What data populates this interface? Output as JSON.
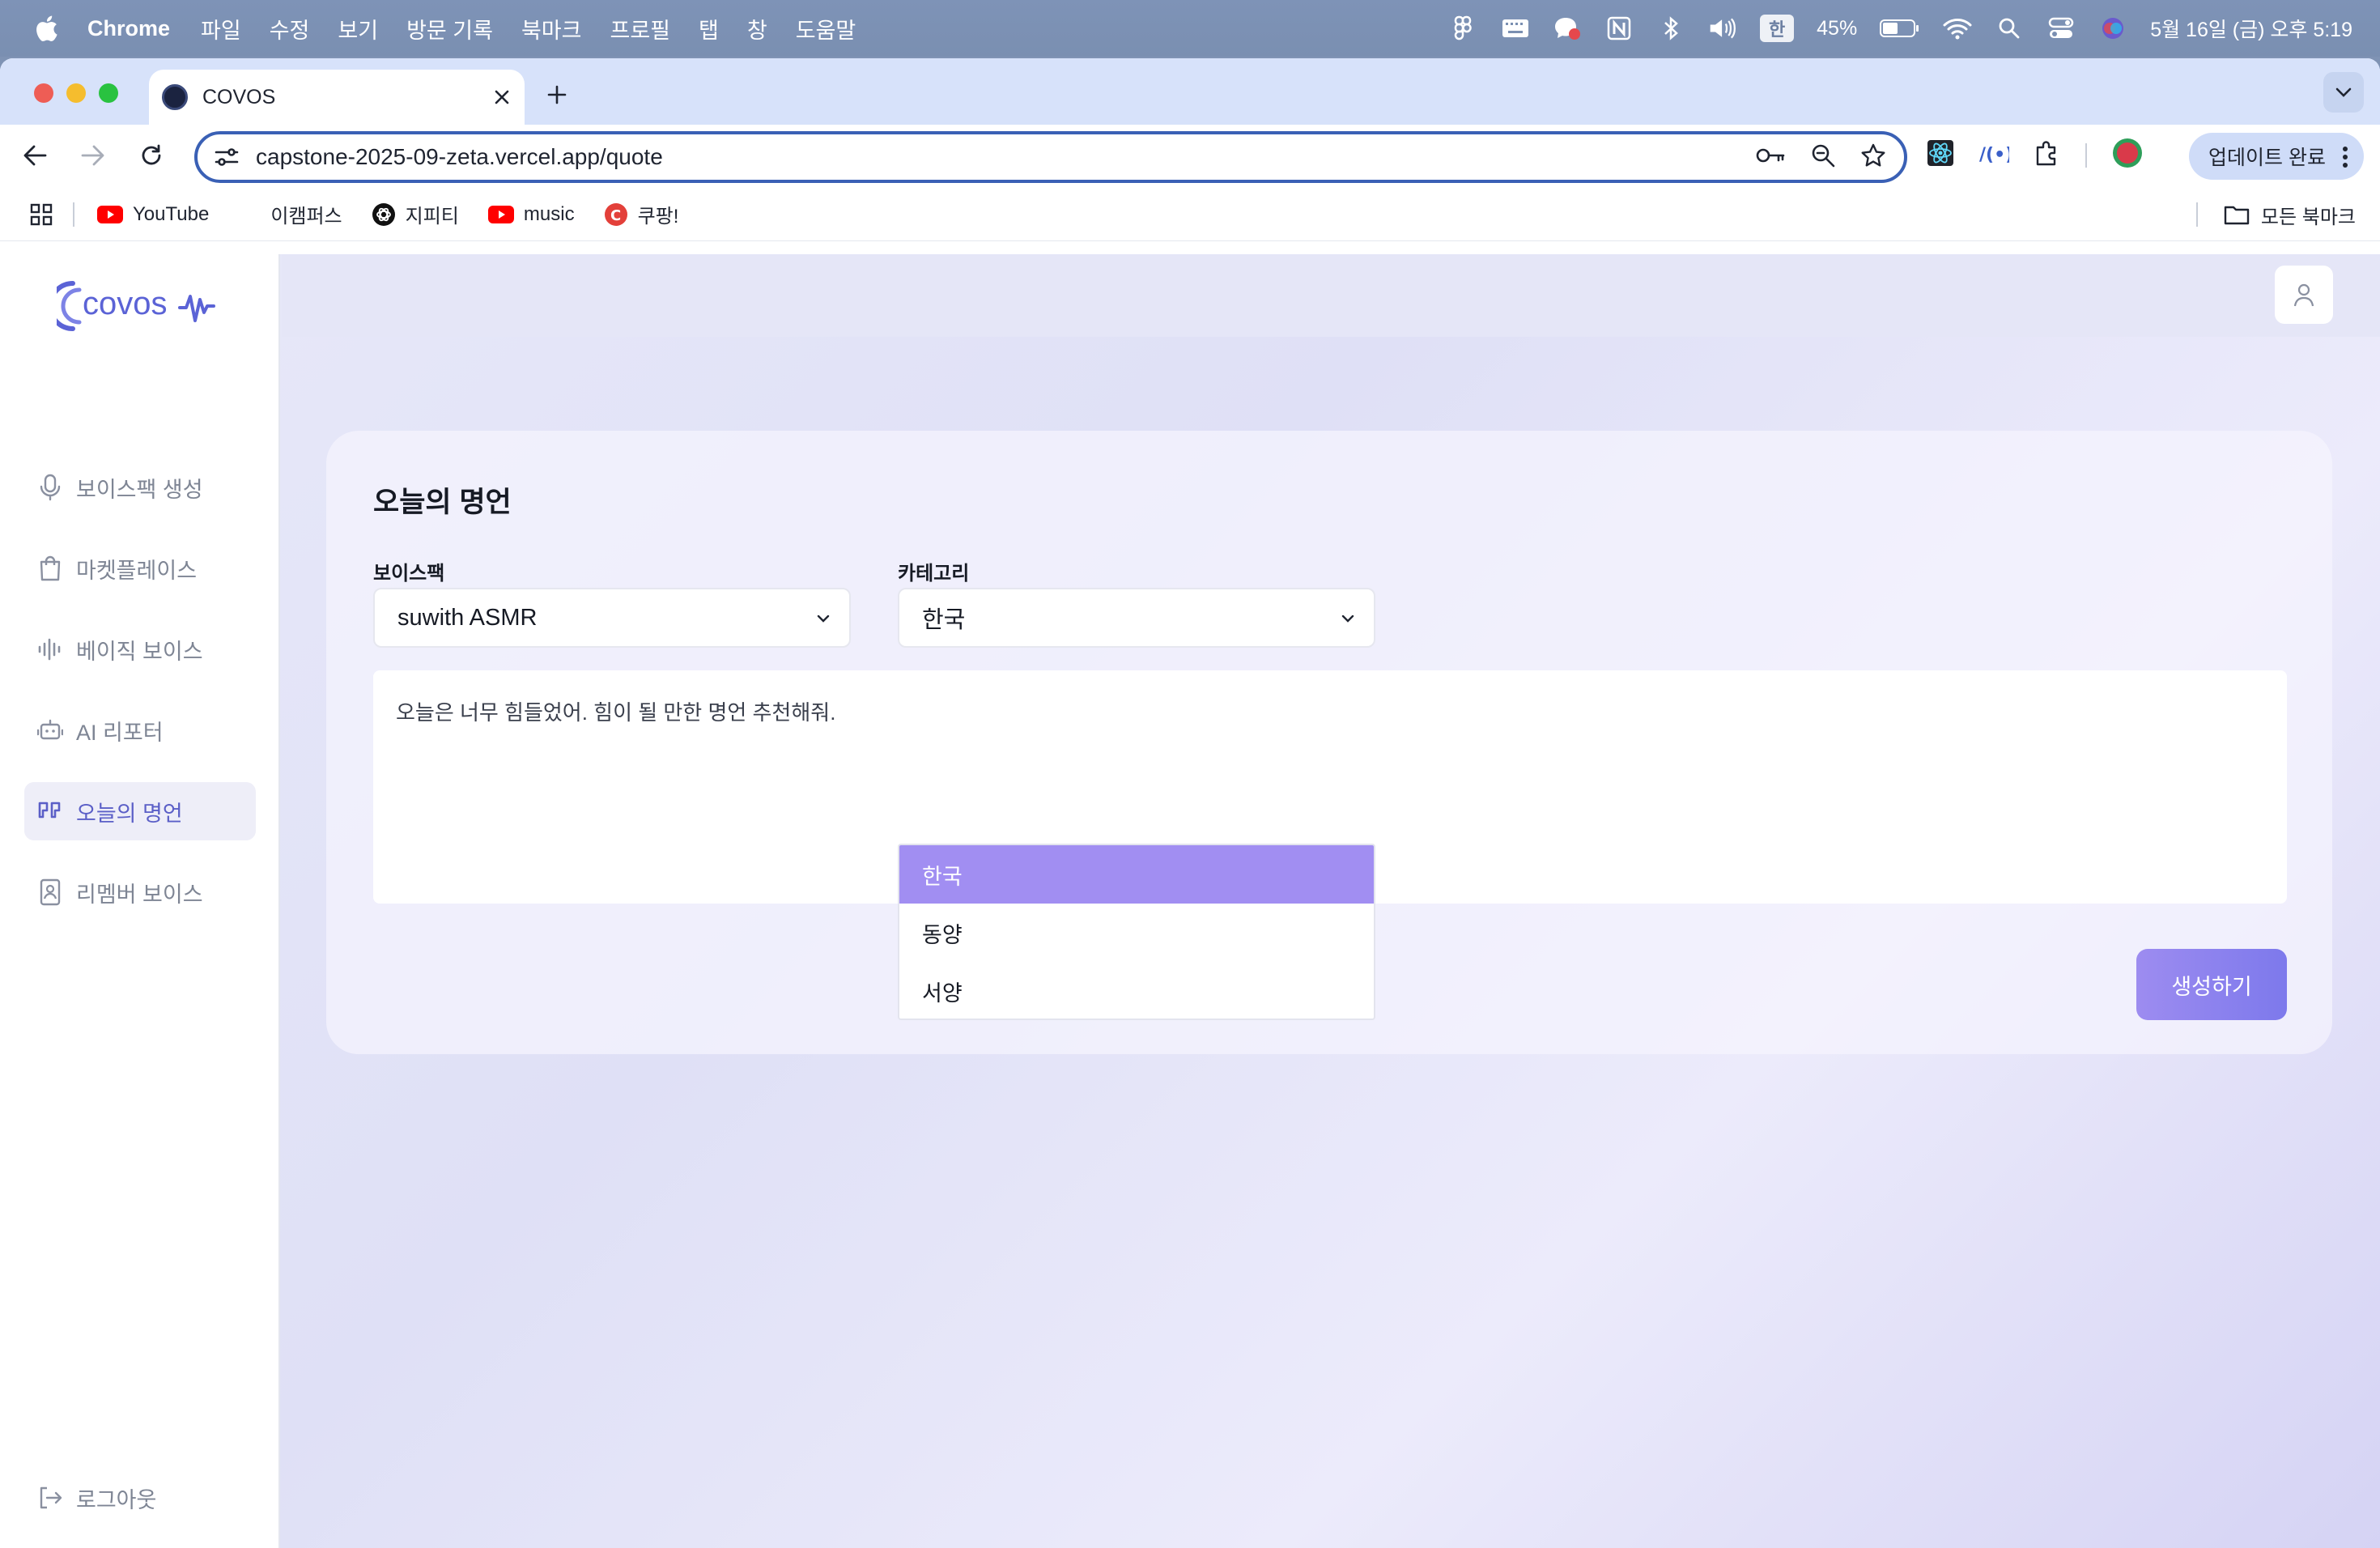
{
  "menubar": {
    "app": "Chrome",
    "items": [
      "파일",
      "수정",
      "보기",
      "방문 기록",
      "북마크",
      "프로필",
      "탭",
      "창",
      "도움말"
    ],
    "ime": "한",
    "battery": "45%",
    "datetime": "5월 16일 (금) 오후 5:19"
  },
  "browser": {
    "tab_title": "COVOS",
    "url": "capstone-2025-09-zeta.vercel.app/quote",
    "update_label": "업데이트 완료",
    "bookmarks": [
      "YouTube",
      "이캠퍼스",
      "지피티",
      "music",
      "쿠팡!"
    ],
    "all_bookmarks": "모든 북마크"
  },
  "sidebar": {
    "logo": "covos",
    "items": [
      {
        "label": "보이스팩 생성",
        "icon": "microphone-icon"
      },
      {
        "label": "마켓플레이스",
        "icon": "shopping-bag-icon"
      },
      {
        "label": "베이직 보이스",
        "icon": "audio-wave-icon"
      },
      {
        "label": "AI 리포터",
        "icon": "bot-icon"
      },
      {
        "label": "오늘의 명언",
        "icon": "quote-icon"
      },
      {
        "label": "리멤버 보이스",
        "icon": "contact-book-icon"
      }
    ],
    "logout": "로그아웃"
  },
  "main": {
    "title": "오늘의 명언",
    "voicepack_label": "보이스팩",
    "voicepack_value": "suwith ASMR",
    "category_label": "카테고리",
    "category_value": "한국",
    "category_options": [
      "한국",
      "동양",
      "서양"
    ],
    "prompt_text": "오늘은 너무 힘들었어. 힘이 될 만한 명언 추천해줘.",
    "generate_label": "생성하기"
  },
  "colors": {
    "accent": "#5b5fc7",
    "selected_option": "#a18ef2",
    "button": "#8a82ee"
  }
}
